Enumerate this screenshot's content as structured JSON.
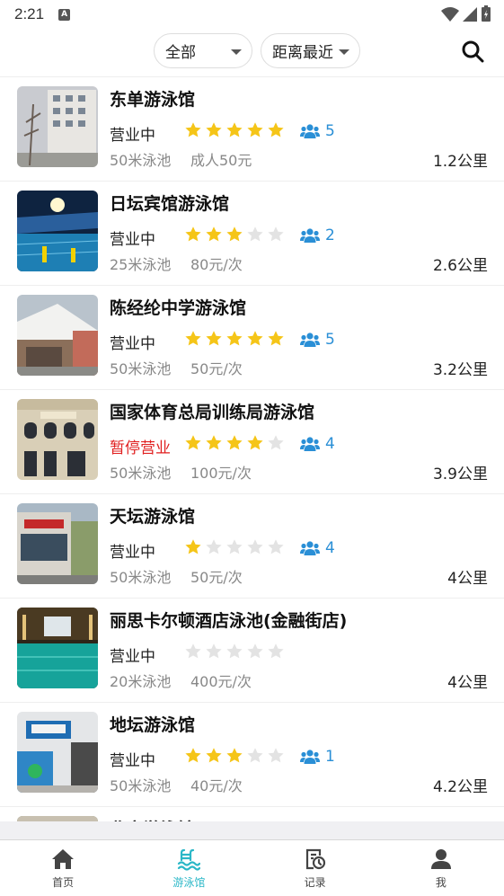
{
  "status_bar": {
    "time": "2:21",
    "notification_badge": "A"
  },
  "filters": {
    "category": "全部",
    "sort": "距离最近"
  },
  "pools": [
    {
      "name": "东单游泳馆",
      "status": "营业中",
      "open": true,
      "rating": 5,
      "people": "5",
      "pool": "50米泳池",
      "price": "成人50元",
      "distance": "1.2公里",
      "thumb": "building"
    },
    {
      "name": "日坛宾馆游泳馆",
      "status": "营业中",
      "open": true,
      "rating": 3,
      "people": "2",
      "pool": "25米泳池",
      "price": "80元/次",
      "distance": "2.6公里",
      "thumb": "indoor"
    },
    {
      "name": "陈经纶中学游泳馆",
      "status": "营业中",
      "open": true,
      "rating": 5,
      "people": "5",
      "pool": "50米泳池",
      "price": "50元/次",
      "distance": "3.2公里",
      "thumb": "tent"
    },
    {
      "name": "国家体育总局训练局游泳馆",
      "status": "暂停营业",
      "open": false,
      "rating": 4,
      "people": "4",
      "pool": "50米泳池",
      "price": "100元/次",
      "distance": "3.9公里",
      "thumb": "classic"
    },
    {
      "name": "天坛游泳馆",
      "status": "营业中",
      "open": true,
      "rating": 1,
      "people": "4",
      "pool": "50米泳池",
      "price": "50元/次",
      "distance": "4公里",
      "thumb": "street"
    },
    {
      "name": "丽思卡尔顿酒店泳池(金融街店)",
      "status": "营业中",
      "open": true,
      "rating": 0,
      "people": "",
      "pool": "20米泳池",
      "price": "400元/次",
      "distance": "4公里",
      "thumb": "hotel"
    },
    {
      "name": "地坛游泳馆",
      "status": "营业中",
      "open": true,
      "rating": 3,
      "people": "1",
      "pool": "50米泳池",
      "price": "40元/次",
      "distance": "4.2公里",
      "thumb": "lobby"
    },
    {
      "name": "北京游泳馆",
      "status": "",
      "open": true,
      "rating": 0,
      "people": "",
      "pool": "",
      "price": "",
      "distance": "",
      "thumb": "partial"
    }
  ],
  "tabs": [
    {
      "label": "首页",
      "icon": "home-icon"
    },
    {
      "label": "游泳馆",
      "icon": "pool-icon"
    },
    {
      "label": "记录",
      "icon": "record-icon"
    },
    {
      "label": "我",
      "icon": "profile-icon"
    }
  ],
  "colors": {
    "accent": "#2ab7c7",
    "star_on": "#f5c518",
    "star_off": "#e3e3e3",
    "people": "#2a8fd6",
    "closed": "#e02020"
  }
}
